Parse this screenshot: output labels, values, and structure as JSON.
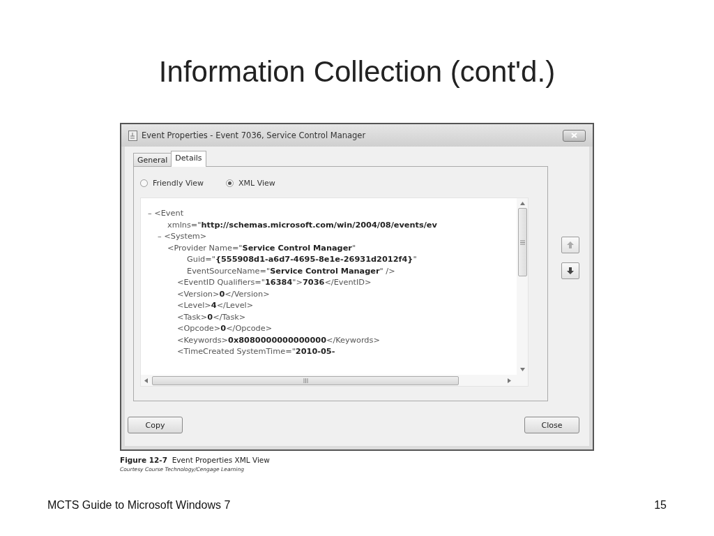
{
  "slide": {
    "title": "Information Collection (cont'd.)",
    "footer": "MCTS Guide to Microsoft Windows 7",
    "page_number": "15"
  },
  "window": {
    "title": "Event Properties - Event 7036, Service Control Manager"
  },
  "tabs": [
    {
      "label": "General",
      "selected": false
    },
    {
      "label": "Details",
      "selected": true
    }
  ],
  "view_options": [
    {
      "label": "Friendly View",
      "selected": false
    },
    {
      "label": "XML View",
      "selected": true
    }
  ],
  "xml_lines": [
    {
      "text": "– <Event",
      "children": [
        {
          "text": "xmlns=\"**http://schemas.microsoft.com/win/2004/08/events/ev**"
        },
        {
          "text": "– <System>",
          "children": [
            {
              "text": "<Provider Name=\"**Service Control Manager**\"",
              "children": [
                {
                  "text": "Guid=\"**{555908d1-a6d7-4695-8e1e-26931d2012f4}**\""
                },
                {
                  "text": "EventSourceName=\"**Service Control Manager**\" />"
                }
              ]
            },
            {
              "text": "<EventID Qualifiers=\"**16384**\">**7036**</EventID>"
            },
            {
              "text": "<Version>**0**</Version>"
            },
            {
              "text": "<Level>**4**</Level>"
            },
            {
              "text": "<Task>**0**</Task>"
            },
            {
              "text": "<Opcode>**0**</Opcode>"
            },
            {
              "text": "<Keywords>**0x8080000000000000**</Keywords>"
            },
            {
              "text": "<TimeCreated SystemTime=\"**2010-05-**"
            }
          ]
        }
      ]
    }
  ],
  "side_buttons": [
    {
      "kind": "up",
      "disabled": true
    },
    {
      "kind": "down",
      "disabled": false
    }
  ],
  "buttons": [
    "Copy",
    "Close"
  ],
  "caption": {
    "text": "**Figure 12-7**  Event Properties XML View",
    "credit": "Courtesy Course Technology/Cengage Learning"
  }
}
